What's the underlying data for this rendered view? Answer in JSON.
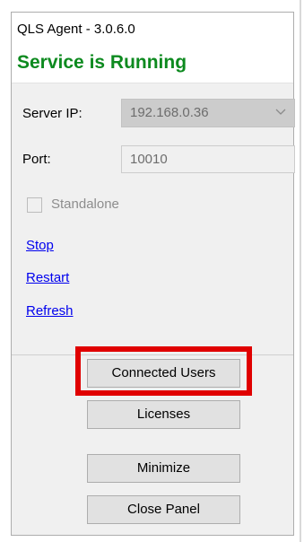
{
  "window": {
    "title": "QLS Agent - 3.0.6.0",
    "status": "Service is Running",
    "status_color": "#0d8a1f"
  },
  "form": {
    "server_ip_label": "Server IP:",
    "server_ip_value": "192.168.0.36",
    "port_label": "Port:",
    "port_value": "10010",
    "standalone_label": "Standalone",
    "standalone_checked": false
  },
  "links": {
    "stop": "Stop",
    "restart": "Restart",
    "refresh": "Refresh"
  },
  "buttons": {
    "connected_users": "Connected Users",
    "licenses": "Licenses",
    "minimize": "Minimize",
    "close_panel": "Close Panel"
  },
  "colors": {
    "highlight": "#e00000",
    "link": "#0000ee"
  },
  "icons": {
    "combo_dropdown": "chevron-down-icon"
  }
}
